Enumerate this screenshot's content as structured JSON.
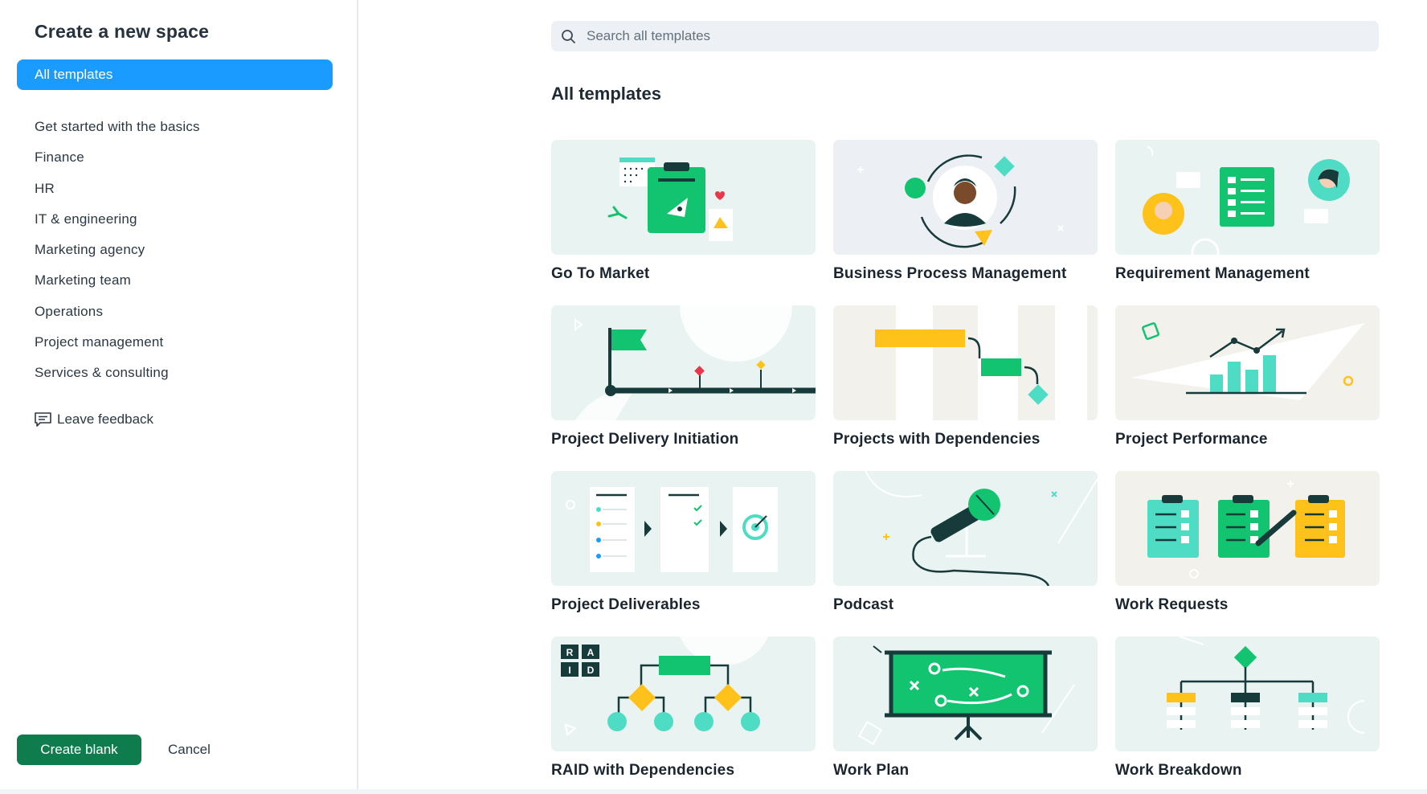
{
  "sidebar": {
    "title": "Create a new space",
    "active_item": "All templates",
    "categories": [
      "Get started with the basics",
      "Finance",
      "HR",
      "IT & engineering",
      "Marketing agency",
      "Marketing team",
      "Operations",
      "Project management",
      "Services & consulting"
    ],
    "feedback_label": "Leave feedback",
    "create_blank_label": "Create blank",
    "cancel_label": "Cancel"
  },
  "search": {
    "placeholder": "Search all templates",
    "value": ""
  },
  "main": {
    "title": "All templates",
    "templates": [
      {
        "label": "Go To Market",
        "icon": "go-to-market-illustration"
      },
      {
        "label": "Business Process Management",
        "icon": "business-process-illustration"
      },
      {
        "label": "Requirement Management",
        "icon": "requirement-management-illustration"
      },
      {
        "label": "Project Delivery Initiation",
        "icon": "project-delivery-illustration"
      },
      {
        "label": "Projects with Dependencies",
        "icon": "projects-dependencies-illustration"
      },
      {
        "label": "Project Performance",
        "icon": "project-performance-illustration"
      },
      {
        "label": "Project Deliverables",
        "icon": "project-deliverables-illustration"
      },
      {
        "label": "Podcast",
        "icon": "podcast-illustration"
      },
      {
        "label": "Work Requests",
        "icon": "work-requests-illustration"
      },
      {
        "label": "RAID with Dependencies",
        "icon": "raid-dependencies-illustration"
      },
      {
        "label": "Work Plan",
        "icon": "work-plan-illustration"
      },
      {
        "label": "Work Breakdown",
        "icon": "work-breakdown-illustration"
      }
    ],
    "raid_letters": [
      "R",
      "A",
      "I",
      "D"
    ]
  },
  "colors": {
    "accent_blue": "#1a9bff",
    "primary_green": "#0f7c4d",
    "illustration_green": "#12c46f",
    "illustration_teal": "#4fdcc4",
    "illustration_yellow": "#ffc21a",
    "illustration_dark": "#173a3a",
    "thumb_mint": "#e9f3f1",
    "thumb_beige": "#f3f1ec",
    "thumb_gray": "#eceff3"
  }
}
